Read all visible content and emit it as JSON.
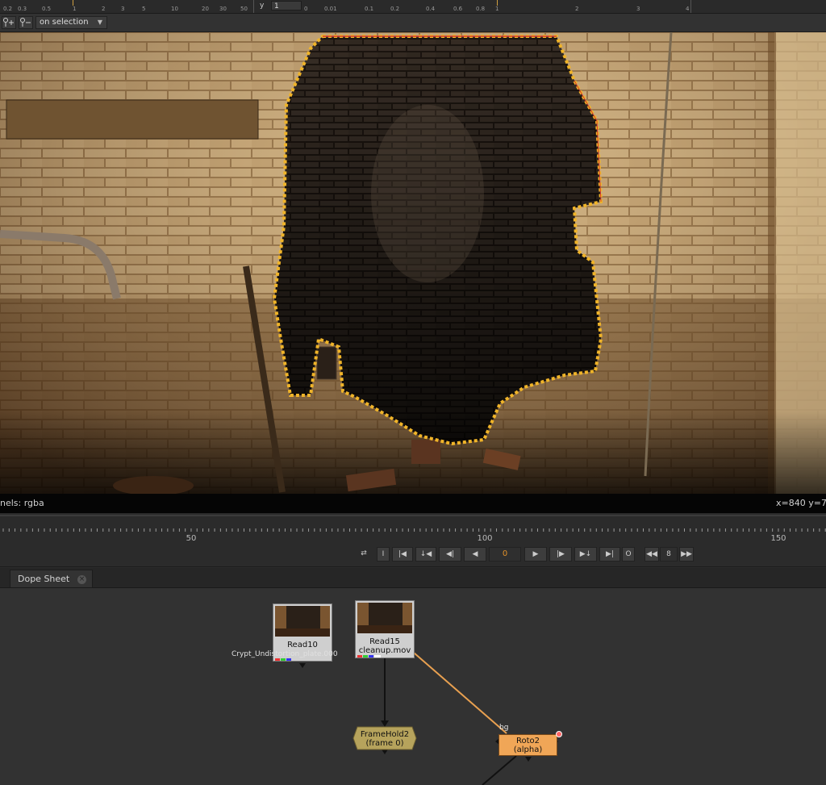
{
  "top_strip": {
    "left_ticks": [
      "0.2",
      "0.3",
      "0.5",
      "1",
      "2",
      "3",
      "5",
      "10",
      "20",
      "30",
      "50"
    ],
    "y_label": "y",
    "y_value": "1",
    "right_ticks": [
      "0",
      "0.01",
      "0.1",
      "0.2",
      "0.4",
      "0.6",
      "0.8",
      "1",
      "2",
      "3",
      "4"
    ]
  },
  "toolbar": {
    "add_point_icon": "pin-add-icon",
    "remove_point_icon": "pin-remove-icon",
    "selection_mode": "on selection"
  },
  "viewer": {
    "channels_label": "nels: rgba",
    "coords_label": "x=840 y=7"
  },
  "timeline": {
    "labels": [
      "50",
      "100",
      "150"
    ]
  },
  "transport": {
    "in_label": "I",
    "out_label": "O",
    "current_frame": "0",
    "increment": "8",
    "loop_icon": "loop-icon",
    "first_icon": "first-frame-icon",
    "prev_key_icon": "prev-keyframe-icon",
    "prev_inc_icon": "step-back-increment-icon",
    "prev_frame_icon": "step-back-icon",
    "play_back_icon": "play-backward-icon",
    "play_fwd_icon": "play-forward-icon",
    "next_frame_icon": "step-forward-icon",
    "next_inc_icon": "step-forward-increment-icon",
    "next_key_icon": "next-keyframe-icon",
    "last_icon": "last-frame-icon",
    "rewind_icon": "rewind-icon",
    "ffwd_icon": "fast-forward-icon"
  },
  "tabs": {
    "dope_sheet": "Dope Sheet"
  },
  "nodes": {
    "read10_name": "Read10",
    "read10_file": "Crypt_Undistortion_plate.000",
    "read15_name": "Read15",
    "read15_file": "cleanup.mov",
    "framehold_name": "FrameHold2",
    "framehold_sub": "(frame 0)",
    "roto_name": "Roto2",
    "roto_sub": "(alpha)",
    "bg_label": "bg"
  },
  "colors": {
    "frame_number": "#e0902a",
    "roto_node": "#f0a657",
    "framehold_node": "#b6a35c",
    "selection_outline": "#f0b429",
    "pipe_line": "#e8a050"
  }
}
